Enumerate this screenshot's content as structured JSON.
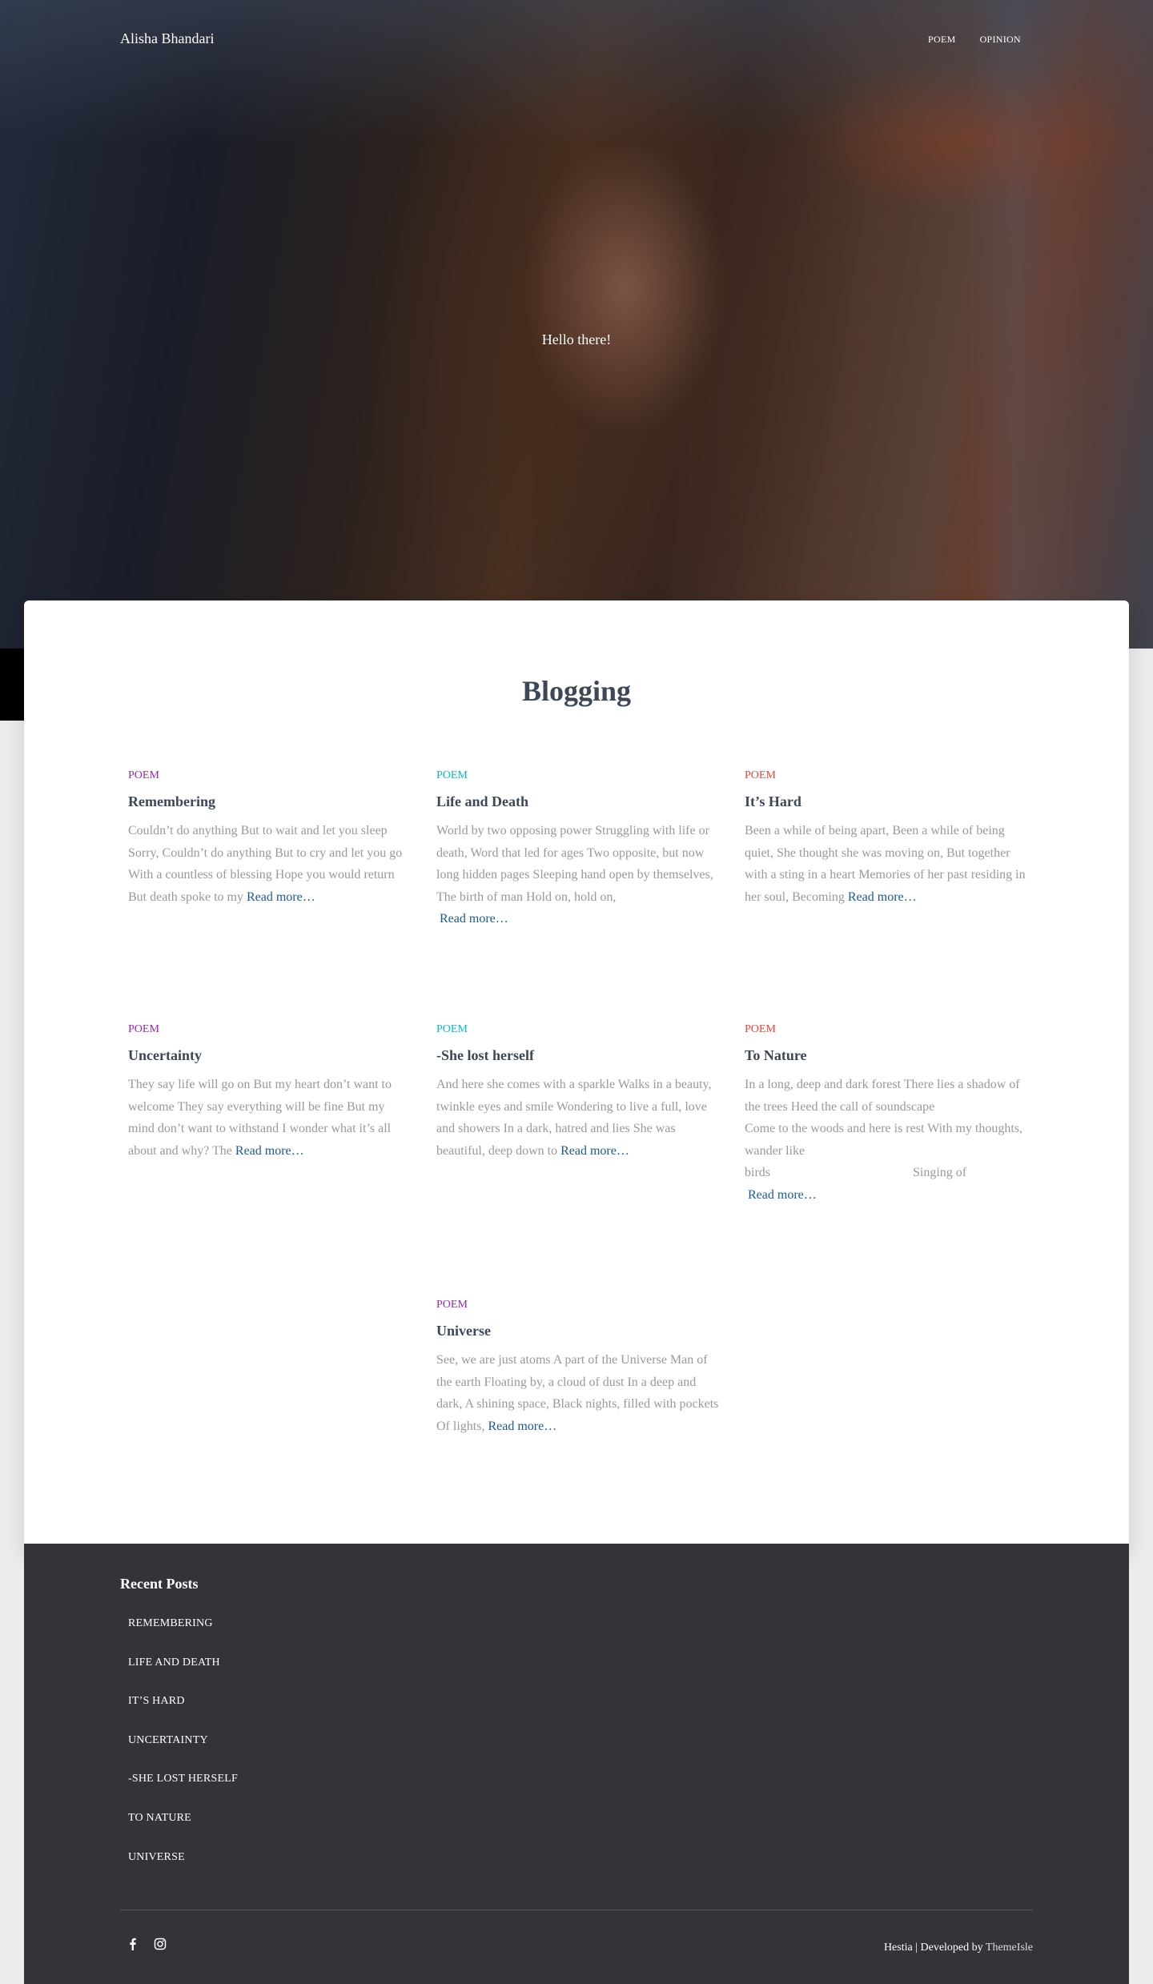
{
  "header": {
    "brand": "Alisha Bhandari",
    "nav": [
      "POEM",
      "OPINION"
    ],
    "hero_title": "Hello there!"
  },
  "blog": {
    "title": "Blogging",
    "read_more": "Read more…",
    "posts": [
      {
        "category": "POEM",
        "title": "Remembering",
        "excerpt": "Couldn’t do anything But to wait and let you sleep Sorry, Couldn’t do anything But to cry and let you go With a countless of blessing Hope you would return But death spoke to my"
      },
      {
        "category": "POEM",
        "title": "Life and Death",
        "excerpt": "World by two opposing power Struggling with life or death, Word that led for ages Two opposite, but now long hidden pages Sleeping hand open by themselves, The birth of man Hold on, hold on,"
      },
      {
        "category": "POEM",
        "title": "It’s Hard",
        "excerpt": "Been a while of being apart, Been a while of being quiet, She thought she was moving on, But together with a sting in a heart Memories of her past residing in her soul, Becoming"
      },
      {
        "category": "POEM",
        "title": "Uncertainty",
        "excerpt": "They say life will go on But my heart don’t want to welcome They say everything will be fine But my mind don’t want to withstand I wonder what it’s all about and why? The"
      },
      {
        "category": "POEM",
        "title": "-She lost herself",
        "excerpt": "And here she comes with a sparkle Walks in a beauty, twinkle eyes and smile Wondering to live a full, love and showers In a dark, hatred and lies She was beautiful, deep down to"
      },
      {
        "category": "POEM",
        "title": "To Nature",
        "excerpt_lines": [
          "In a long, deep and dark forest There lies a shadow of the trees  Heed the call of soundscape",
          "Come to the woods and here is rest With my thoughts, wander like",
          "birds",
          "Singing of"
        ]
      },
      {
        "category": "POEM",
        "title": "Universe",
        "excerpt": "See, we are just atoms A part of the Universe Man of the earth Floating by, a cloud of dust In a deep and dark, A shining space, Black nights, filled with pockets Of lights,"
      }
    ]
  },
  "footer": {
    "recent_title": "Recent Posts",
    "recent_posts": [
      "REMEMBERING",
      "LIFE AND DEATH",
      "IT’S HARD",
      "UNCERTAINTY",
      "-SHE LOST HERSELF",
      "TO NATURE",
      "UNIVERSE"
    ],
    "credits_prefix": "Hestia | Developed by ",
    "credits_link": "ThemeIsle",
    "social_icons": [
      "facebook-icon",
      "instagram-icon"
    ]
  },
  "colors": {
    "poem_purple": "#9c27b0",
    "poem_cyan": "#00bcd4",
    "poem_red": "#f44336",
    "read_more": "#1a5a96",
    "footer_bg": "#323437"
  }
}
